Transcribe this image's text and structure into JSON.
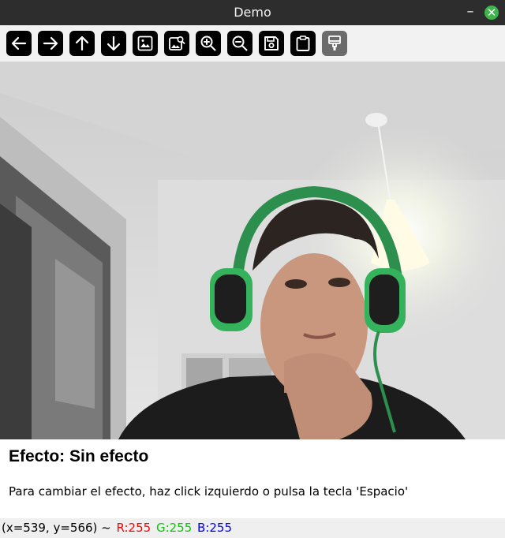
{
  "window": {
    "title": "Demo",
    "minimize_glyph": "–",
    "close_glyph": "✕"
  },
  "toolbar": {
    "buttons": [
      {
        "icon": "arrow-left-icon"
      },
      {
        "icon": "arrow-right-icon"
      },
      {
        "icon": "arrow-up-icon"
      },
      {
        "icon": "arrow-down-icon"
      },
      {
        "icon": "image-icon"
      },
      {
        "icon": "image-search-icon"
      },
      {
        "icon": "zoom-in-icon"
      },
      {
        "icon": "zoom-out-icon"
      },
      {
        "icon": "save-icon"
      },
      {
        "icon": "clipboard-icon"
      },
      {
        "icon": "paint-brush-icon",
        "disabled": true
      }
    ]
  },
  "caption": {
    "effect_title": "Efecto: Sin efecto",
    "instructions": "Para cambiar el efecto, haz click izquierdo o pulsa la tecla 'Espacio'"
  },
  "status": {
    "coords": "(x=539, y=566) ~",
    "r": "R:255",
    "g": "G:255",
    "b": "B:255",
    "colors": {
      "r": "#ff0000",
      "g": "#00cc00",
      "b": "#0000ff"
    }
  }
}
